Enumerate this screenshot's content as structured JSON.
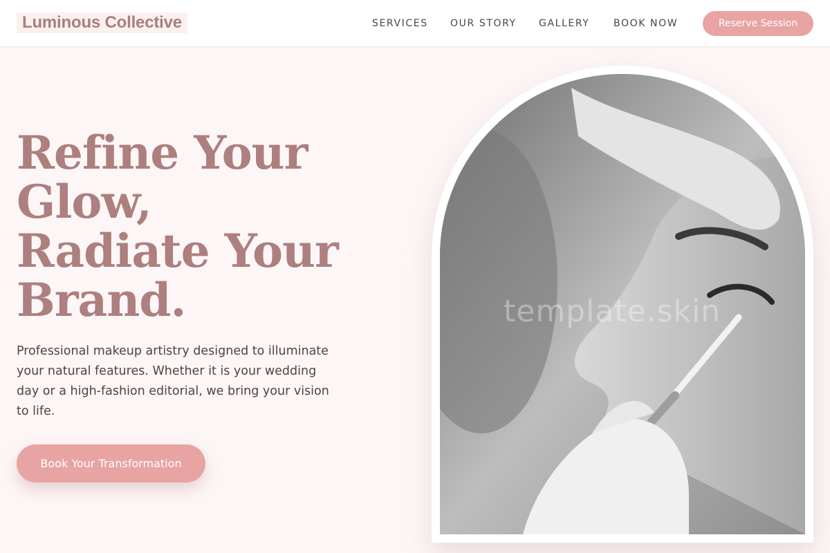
{
  "header": {
    "logo": "Luminous Collective",
    "nav": [
      "SERVICES",
      "OUR STORY",
      "GALLERY",
      "BOOK NOW"
    ],
    "reserve_label": "Reserve Session"
  },
  "hero": {
    "headline_lines": [
      "Refine Your",
      "Glow,",
      "Radiate Your",
      "Brand."
    ],
    "description": "Professional makeup artistry designed to illuminate your natural features. Whether it is your wedding day or a high-fashion editorial, we bring your vision to life.",
    "cta_label": "Book Your Transformation",
    "image_watermark": "template.skin"
  },
  "colors": {
    "accent": "#e8a3a3",
    "headline": "#ad7f7f",
    "background": "#fdf6f6"
  }
}
